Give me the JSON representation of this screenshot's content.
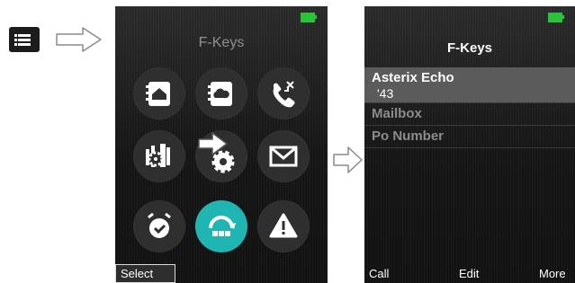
{
  "menu_key": {
    "icon": "menu-list-icon"
  },
  "arrows": {
    "icon": "right-arrow-outline-icon"
  },
  "screen_fkeys_menu": {
    "title": "F-Keys",
    "battery_icon": "battery-icon",
    "apps": [
      {
        "icon": "contacts-icon"
      },
      {
        "icon": "cloud-contacts-icon"
      },
      {
        "icon": "call-log-icon"
      },
      {
        "icon": "phone-settings-icon"
      },
      {
        "icon": "settings-icon"
      },
      {
        "icon": "mail-icon"
      },
      {
        "icon": "alarm-icon"
      },
      {
        "icon": "f-keys-icon",
        "selected": true
      },
      {
        "icon": "alert-icon"
      }
    ],
    "softkeys": {
      "left": "Select"
    },
    "accent_color": "#1fb5b2"
  },
  "screen_fkeys_list": {
    "title": "F-Keys",
    "battery_icon": "battery-icon",
    "items": [
      {
        "label": "Asterix Echo",
        "number": "'43",
        "selected": true
      },
      {
        "label": "Mailbox"
      },
      {
        "label": "Po Number"
      }
    ],
    "softkeys": {
      "left": "Call",
      "center": "Edit",
      "right": "More"
    }
  }
}
